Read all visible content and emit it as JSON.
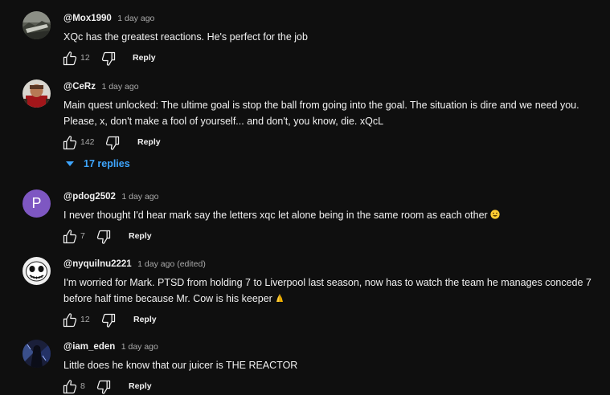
{
  "comments": [
    {
      "author": "@Mox1990",
      "time": "1 day ago",
      "text": "XQc has the greatest reactions. He's perfect for the job",
      "likes": "12",
      "reply": "Reply",
      "avatar_icon": "avatar-landscape"
    },
    {
      "author": "@CeRz",
      "time": "1 day ago",
      "text": "Main quest unlocked: The ultime goal is stop the ball from going into the goal. The situation is dire and we need you. Please, x, don't make a fool of yourself... and don't, you know, die. xQcL",
      "likes": "142",
      "reply": "Reply",
      "replies": "17 replies",
      "avatar_icon": "avatar-character"
    },
    {
      "author": "@pdog2502",
      "time": "1 day ago",
      "text": "I never thought I'd hear mark say the letters xqc let alone being in the same room as each other",
      "emoji": "grinning-face-emoji",
      "likes": "7",
      "reply": "Reply",
      "avatar_letter": "P",
      "avatar_color": "#7e57c2"
    },
    {
      "author": "@nyquilnu2221",
      "time": "1 day ago (edited)",
      "text": "I'm worried for Mark. PTSD from holding 7 to Liverpool last season, now has to watch the team he manages concede 7 before half time because Mr. Cow is his keeper",
      "emoji": "folded-hands-emoji",
      "likes": "12",
      "reply": "Reply",
      "avatar_icon": "avatar-skull-face"
    },
    {
      "author": "@iam_eden",
      "time": "1 day ago",
      "text": "Little does he know that our juicer is THE REACTOR",
      "likes": "8",
      "reply": "Reply",
      "avatar_icon": "avatar-dark-figure"
    }
  ],
  "colors": {
    "background": "#0f0f0f",
    "text": "#f1f1f1",
    "secondary": "#aaaaaa",
    "link": "#3ea6ff"
  }
}
